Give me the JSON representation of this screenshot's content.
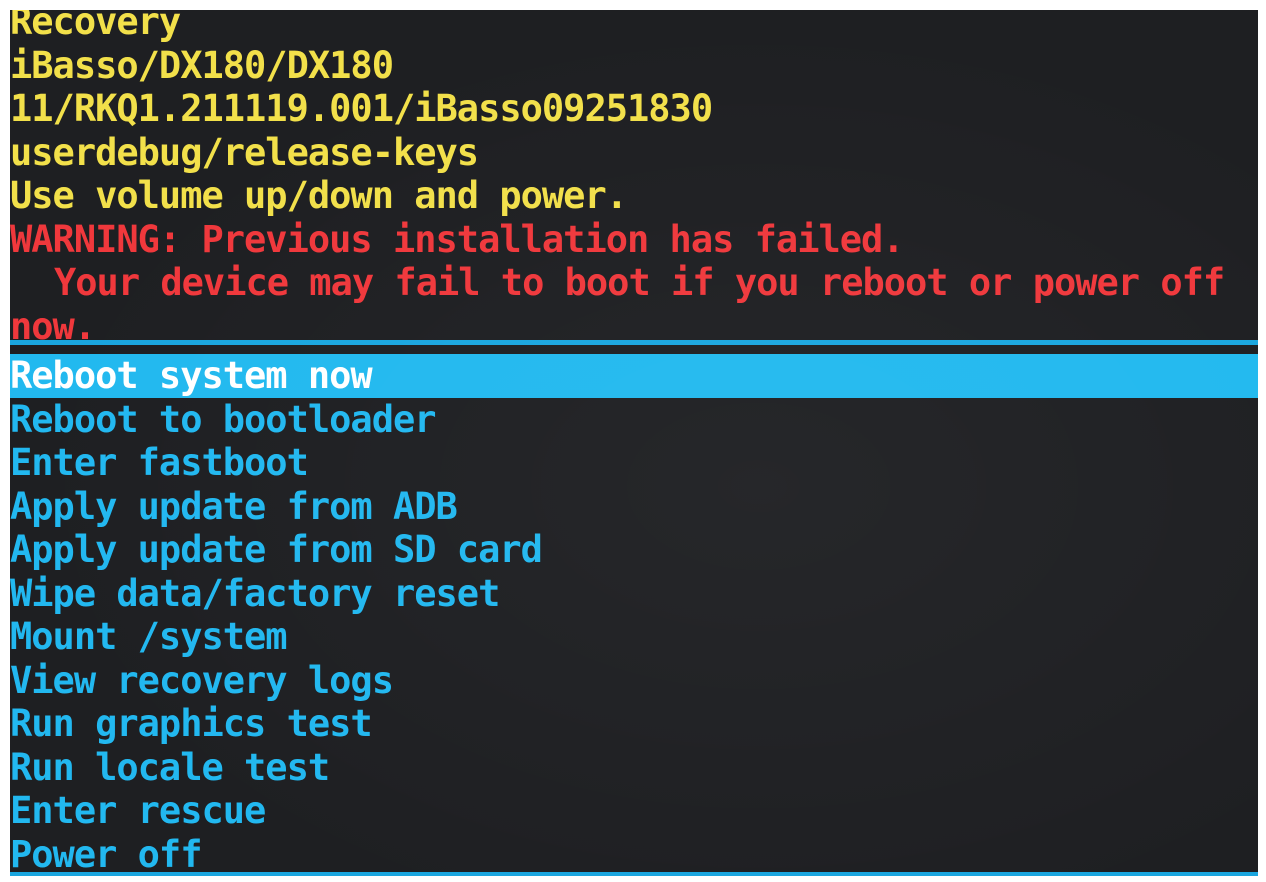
{
  "header": {
    "info_lines": [
      "Recovery",
      "iBasso/DX180/DX180",
      "11/RKQ1.211119.001/iBasso09251830",
      "userdebug/release-keys",
      "Use volume up/down and power."
    ],
    "warning_lines": [
      "WARNING: Previous installation has failed.",
      "Your device may fail to boot if you reboot or power off",
      "now."
    ]
  },
  "menu": {
    "selected_index": 0,
    "items": [
      {
        "label": "Reboot system now"
      },
      {
        "label": "Reboot to bootloader"
      },
      {
        "label": "Enter fastboot"
      },
      {
        "label": "Apply update from ADB"
      },
      {
        "label": "Apply update from SD card"
      },
      {
        "label": "Wipe data/factory reset"
      },
      {
        "label": "Mount /system"
      },
      {
        "label": "View recovery logs"
      },
      {
        "label": "Run graphics test"
      },
      {
        "label": "Run locale test"
      },
      {
        "label": "Enter rescue"
      },
      {
        "label": "Power off"
      }
    ]
  },
  "colors": {
    "background": "#1e1f22",
    "info_text": "#f2e04a",
    "warning_text": "#f0383c",
    "menu_text": "#22b8f0",
    "highlight": "#22b9ef",
    "highlight_text": "#ffffff"
  }
}
